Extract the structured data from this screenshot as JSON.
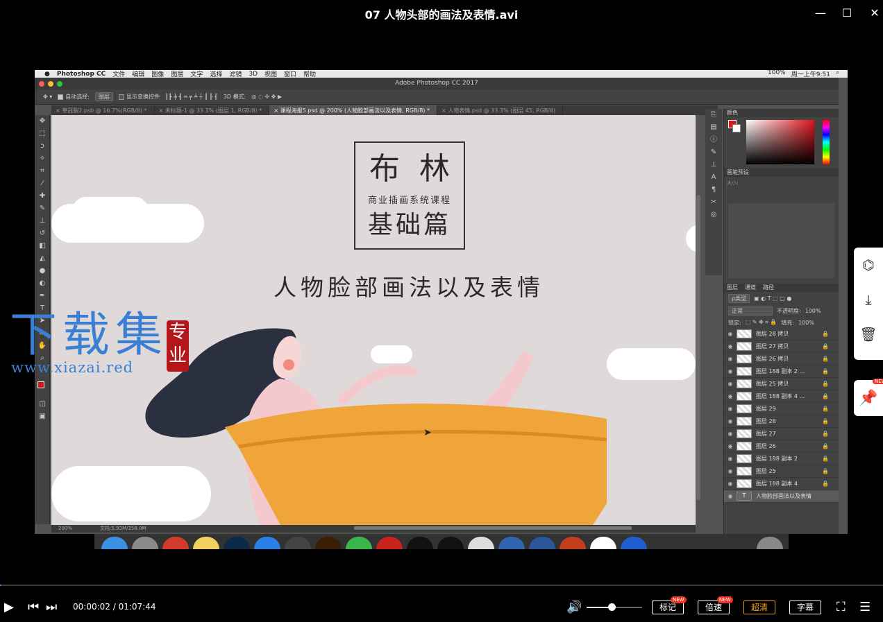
{
  "player": {
    "title": "07 人物头部的画法及表情.avi",
    "controls": {
      "current_time": "00:00:02",
      "duration": "01:07:44",
      "progress": 0.0005,
      "volume": 0.45,
      "buttons": [
        {
          "label": "标记",
          "badge": "NEW"
        },
        {
          "label": "倍速",
          "badge": "NEW"
        },
        {
          "label": "超清",
          "badge": ""
        },
        {
          "label": "字幕",
          "badge": ""
        }
      ]
    },
    "side_badge": "NEW"
  },
  "mac_menubar": {
    "app": "Photoshop CC",
    "menus": [
      "文件",
      "编辑",
      "图像",
      "图层",
      "文字",
      "选择",
      "滤镜",
      "3D",
      "视图",
      "窗口",
      "帮助"
    ],
    "status": [
      "100%",
      "周一上午9:51"
    ]
  },
  "photoshop": {
    "window_title": "Adobe Photoshop CC 2017",
    "options": {
      "auto_select_label": "自动选择:",
      "auto_select_value": "图层",
      "show_transform_label": "显示变换控件",
      "mode_3d": "3D 模式:"
    },
    "tabs": [
      "草冠裂2.psb @ 16.7%(RGB/8) *",
      "未标题-1 @ 33.3% (图层 1, RGB/8) *",
      "课程海报5.psd @ 200% (人物脸部画法以及表情, RGB/8) *",
      "人物表情.psd @ 33.3% (图层 45, RGB/8)"
    ],
    "status": {
      "zoom": "200%",
      "doc": "文档:5.93M/356.0M"
    },
    "panels": {
      "color_tab": "颜色",
      "brush_tab": "画笔预设",
      "brush_size_label": "大小:",
      "layers_tabs": [
        "图层",
        "通道",
        "路径"
      ],
      "filter_kind": "ρ类型",
      "blend_mode": "正常",
      "opacity_label": "不透明度:",
      "opacity_value": "100%",
      "lock_label": "锁定:",
      "fill_label": "填充:",
      "fill_value": "100%"
    },
    "layers": [
      "图层 28 拷贝",
      "图层 27 拷贝",
      "图层 26 拷贝",
      "图层 188 副本 2 ...",
      "图层 25 拷贝",
      "图层 188 副本 4 ...",
      "图层 29",
      "图层 28",
      "图层 27",
      "图层 26",
      "图层 188 副本 2",
      "图层 25",
      "图层 188 副本 4",
      "人物脸部画法以及表情"
    ]
  },
  "artwork": {
    "title_top": "布  林",
    "subtitle": "商业插画系统课程",
    "title_bottom": "基础篇",
    "headline": "人物脸部画法以及表情"
  },
  "watermark": {
    "brand": "下载集",
    "stamp": "专业",
    "url": "www.xiazai.red"
  },
  "colors": {
    "accent": "#2a8cf0",
    "highlight": "#f3a11b",
    "watermark": "#3b7fd4",
    "stamp": "#b4161c",
    "tub": "#f0a53a",
    "hair": "#2b3040"
  }
}
